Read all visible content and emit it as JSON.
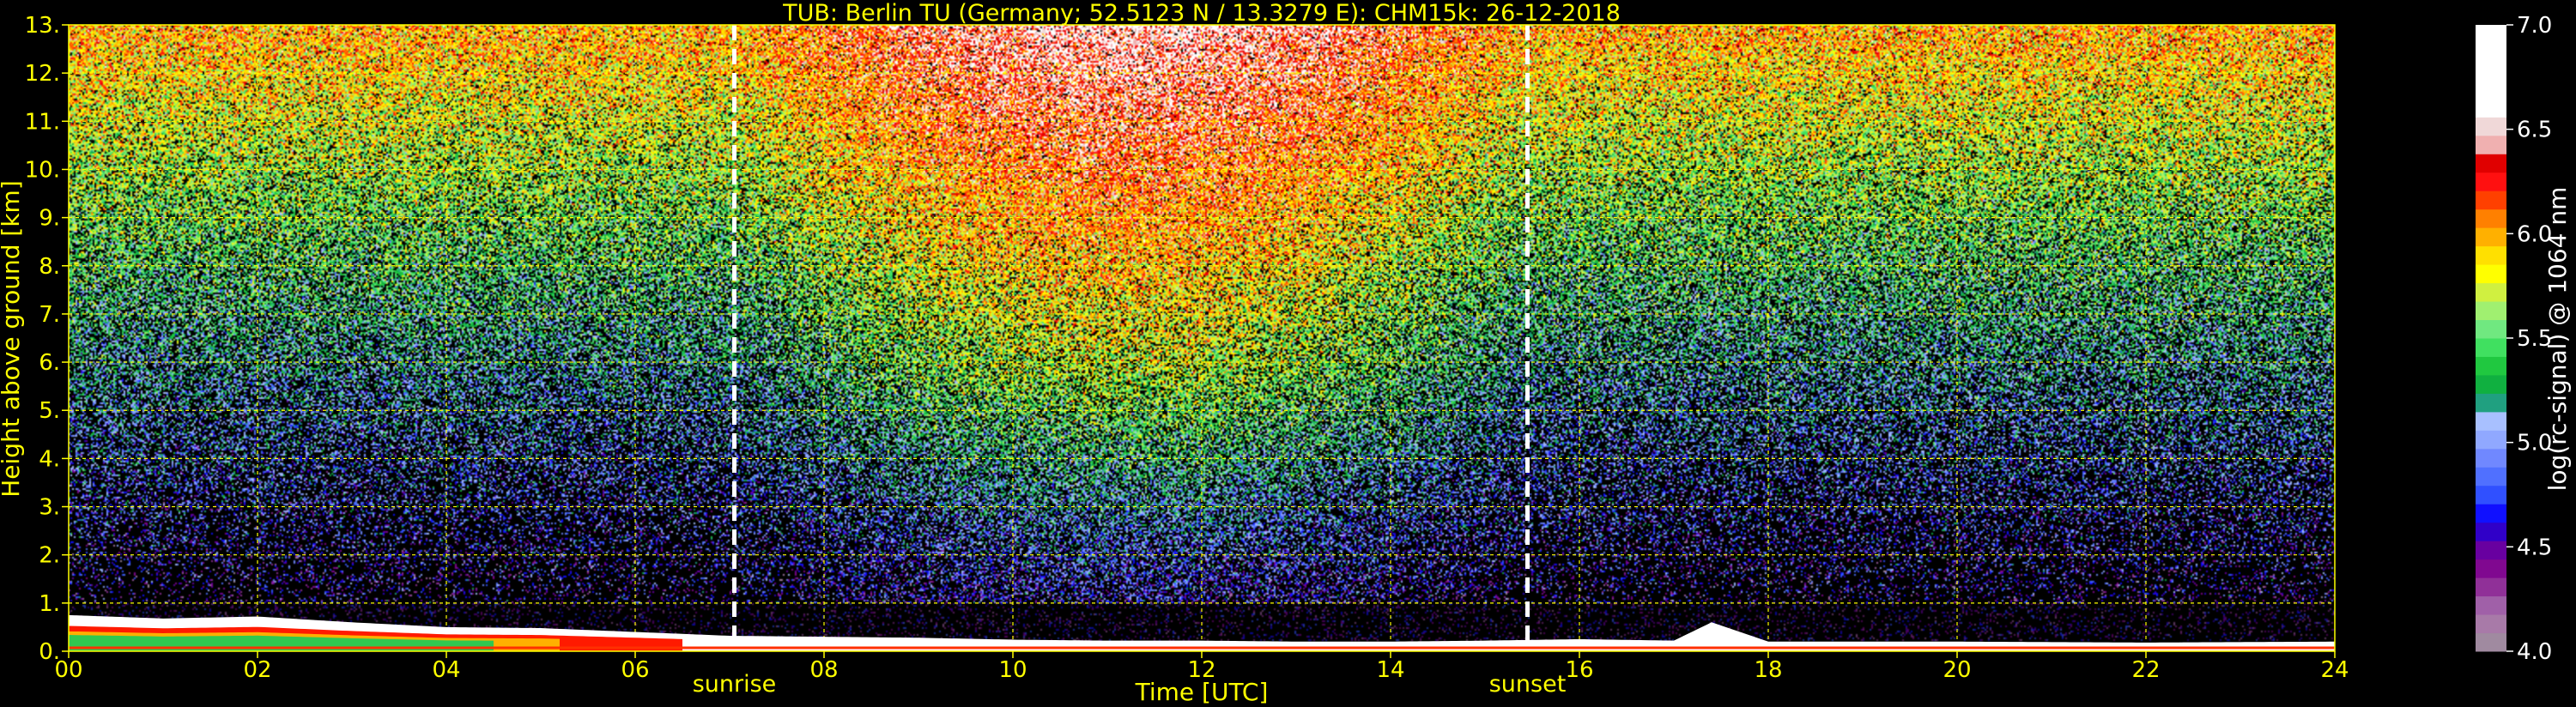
{
  "chart_data": {
    "type": "heatmap",
    "title": "TUB: Berlin TU (Germany; 52.5123 N / 13.3279 E):    CHM15k: 26-12-2018",
    "xlabel": "Time [UTC]",
    "ylabel": "Height above ground [km]",
    "xlim": [
      0,
      24
    ],
    "ylim": [
      0,
      13
    ],
    "x_ticks": [
      "00",
      "02",
      "04",
      "06",
      "08",
      "10",
      "12",
      "14",
      "16",
      "18",
      "20",
      "22",
      "24"
    ],
    "y_ticks": [
      "0.",
      "1.",
      "2.",
      "3.",
      "4.",
      "5.",
      "6.",
      "7.",
      "8.",
      "9.",
      "10.",
      "11.",
      "12.",
      "13."
    ],
    "grid": true,
    "events": [
      {
        "label": "sunrise",
        "time": 7.05
      },
      {
        "label": "sunset",
        "time": 15.45
      }
    ],
    "colorbar": {
      "label": "log(rc-signal) @ 1064 nm",
      "range": [
        4.0,
        7.0
      ],
      "ticks": [
        "4.0",
        "4.5",
        "5.0",
        "5.5",
        "6.0",
        "6.5",
        "7.0"
      ],
      "colors": [
        "#a08aa0",
        "#a87aa8",
        "#a060a8",
        "#903098",
        "#800890",
        "#6800a0",
        "#3000c8",
        "#1010ff",
        "#3050ff",
        "#5070ff",
        "#7088ff",
        "#90a8ff",
        "#a8c0ff",
        "#20a080",
        "#10b040",
        "#20c840",
        "#40e060",
        "#70e880",
        "#a0f070",
        "#d0f040",
        "#ffff00",
        "#ffe000",
        "#ffb000",
        "#ff8000",
        "#ff4000",
        "#ff1010",
        "#e00000",
        "#f0b0b0",
        "#f0d8d8",
        "#ffffff",
        "#ffffff",
        "#ffffff",
        "#ffffff",
        "#ffffff"
      ]
    },
    "boundary_layer": {
      "description_free": true,
      "times": [
        0,
        1,
        2,
        3,
        4,
        5,
        6,
        7,
        8,
        9,
        10,
        11,
        12,
        13,
        14,
        15,
        16,
        17,
        17.4,
        18,
        20,
        22,
        24
      ],
      "top_km": [
        0.75,
        0.68,
        0.72,
        0.6,
        0.5,
        0.48,
        0.4,
        0.32,
        0.3,
        0.28,
        0.24,
        0.22,
        0.22,
        0.2,
        0.2,
        0.22,
        0.25,
        0.22,
        0.6,
        0.2,
        0.2,
        0.18,
        0.2
      ]
    }
  }
}
